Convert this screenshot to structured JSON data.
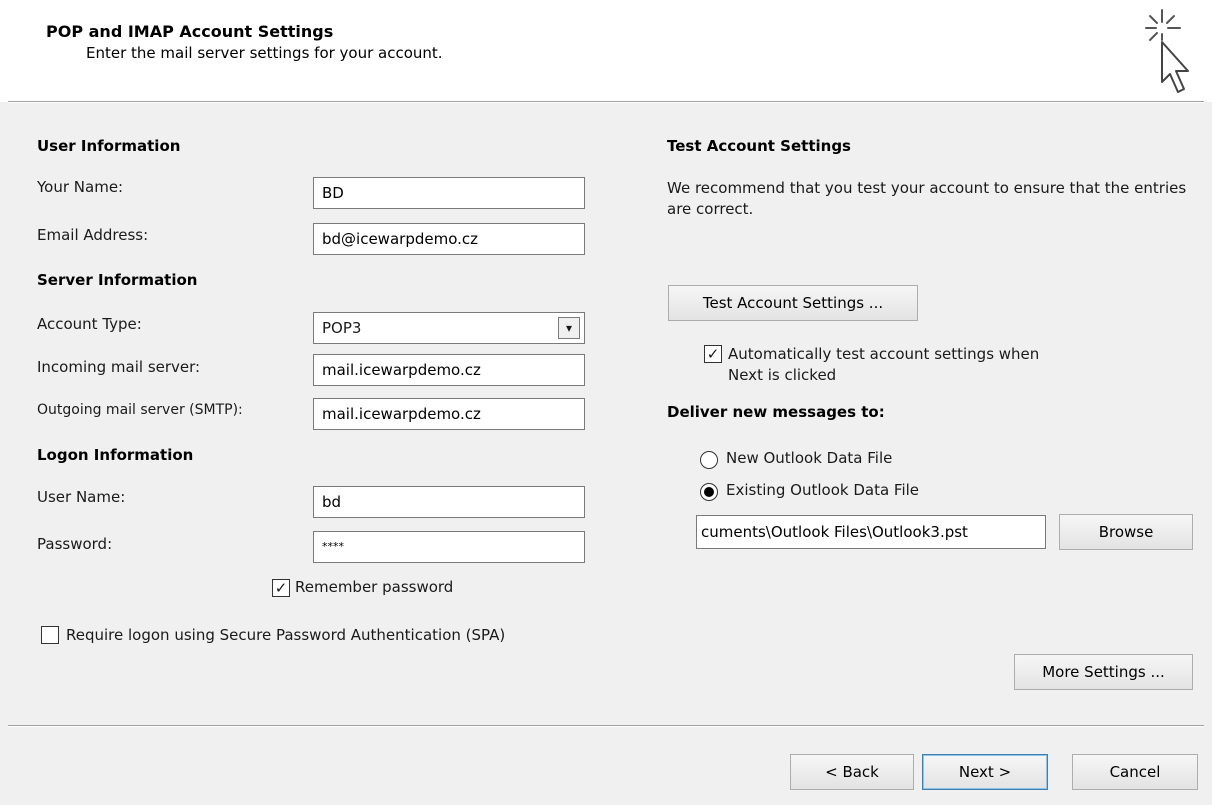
{
  "header": {
    "title": "POP and IMAP Account Settings",
    "subtitle": "Enter the mail server settings for your account."
  },
  "user_info": {
    "heading": "User Information",
    "name_label": "Your Name:",
    "name_value": "BD",
    "email_label": "Email Address:",
    "email_value": "bd@icewarpdemo.cz"
  },
  "server_info": {
    "heading": "Server Information",
    "account_type_label": "Account Type:",
    "account_type_value": "POP3",
    "incoming_label": "Incoming mail server:",
    "incoming_value": "mail.icewarpdemo.cz",
    "outgoing_label": "Outgoing mail server (SMTP):",
    "outgoing_value": "mail.icewarpdemo.cz"
  },
  "logon_info": {
    "heading": "Logon Information",
    "username_label": "User Name:",
    "username_value": "bd",
    "password_label": "Password:",
    "password_value": "****",
    "remember_label": "Remember password",
    "remember_checked": true,
    "spa_label": "Require logon using Secure Password Authentication (SPA)",
    "spa_checked": false
  },
  "test_settings": {
    "heading": "Test Account Settings",
    "description": "We recommend that you test your account to ensure that the entries are correct.",
    "button_label": "Test Account Settings ...",
    "auto_test_label": "Automatically test account settings when Next is clicked",
    "auto_test_checked": true
  },
  "deliver": {
    "heading": "Deliver new messages to:",
    "new_file_label": "New Outlook Data File",
    "existing_file_label": "Existing Outlook Data File",
    "selected": "existing",
    "file_path": "cuments\\Outlook Files\\Outlook3.pst",
    "browse_label": "Browse"
  },
  "more_settings_label": "More Settings ...",
  "footer": {
    "back_label": "< Back",
    "next_label": "Next >",
    "cancel_label": "Cancel"
  },
  "icons": {
    "header_icon": "cursor-sparkle-icon"
  }
}
